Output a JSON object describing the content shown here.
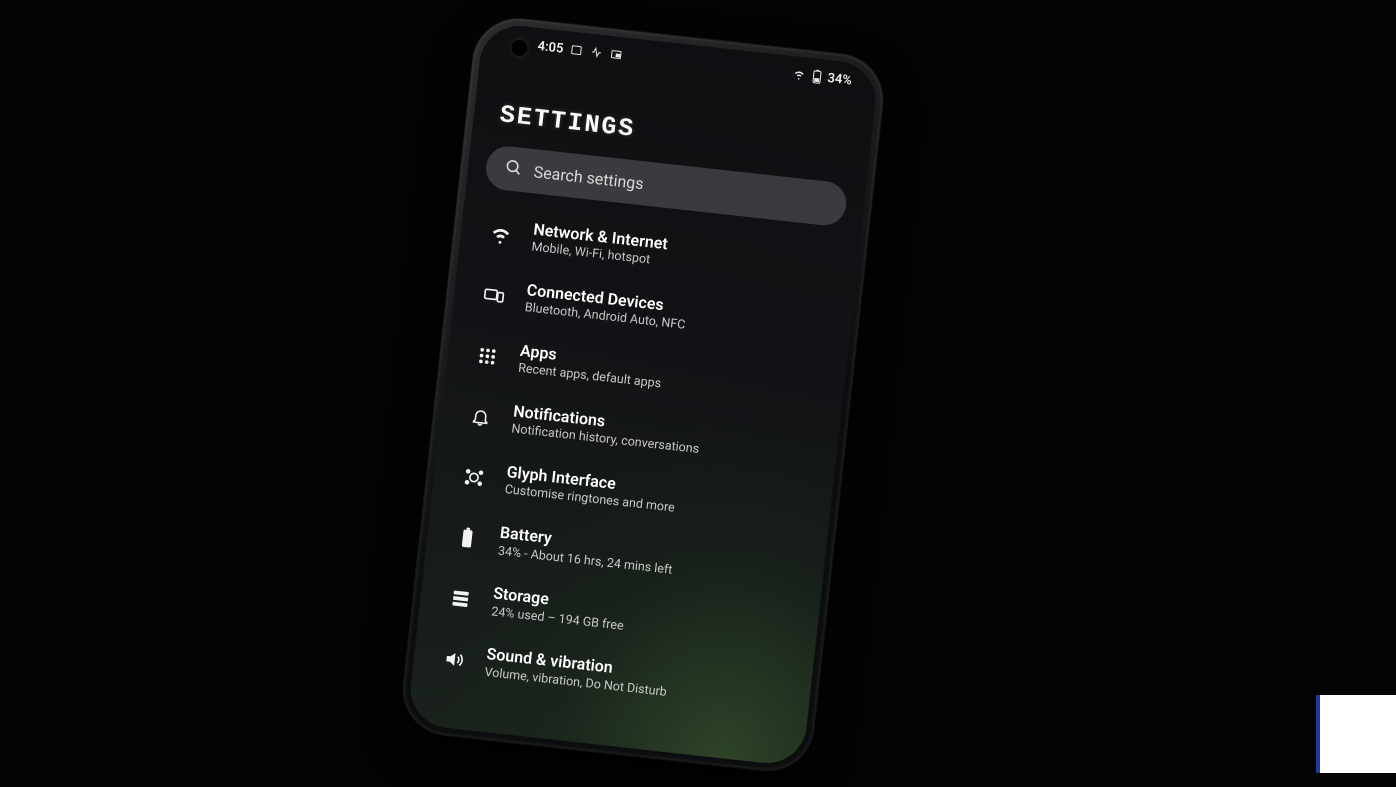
{
  "status_bar": {
    "time": "4:05",
    "left_icons": [
      "app-card-icon",
      "activity-icon",
      "pip-icon"
    ],
    "right": {
      "wifi_icon": "wifi-icon",
      "battery_icon": "battery-icon",
      "battery_text": "34%"
    }
  },
  "page": {
    "title": "SETTINGS"
  },
  "search": {
    "placeholder": "Search settings"
  },
  "items": [
    {
      "icon": "wifi-icon",
      "title": "Network & Internet",
      "subtitle": "Mobile, Wi-Fi, hotspot"
    },
    {
      "icon": "devices-icon",
      "title": "Connected Devices",
      "subtitle": "Bluetooth, Android Auto, NFC"
    },
    {
      "icon": "apps-grid-icon",
      "title": "Apps",
      "subtitle": "Recent apps, default apps"
    },
    {
      "icon": "bell-icon",
      "title": "Notifications",
      "subtitle": "Notification history, conversations"
    },
    {
      "icon": "glyph-icon",
      "title": "Glyph Interface",
      "subtitle": "Customise ringtones and more"
    },
    {
      "icon": "battery-solid-icon",
      "title": "Battery",
      "subtitle": "34% - About 16 hrs, 24 mins left"
    },
    {
      "icon": "storage-icon",
      "title": "Storage",
      "subtitle": "24% used – 194 GB free"
    },
    {
      "icon": "volume-icon",
      "title": "Sound & vibration",
      "subtitle": "Volume, vibration, Do Not Disturb"
    }
  ]
}
